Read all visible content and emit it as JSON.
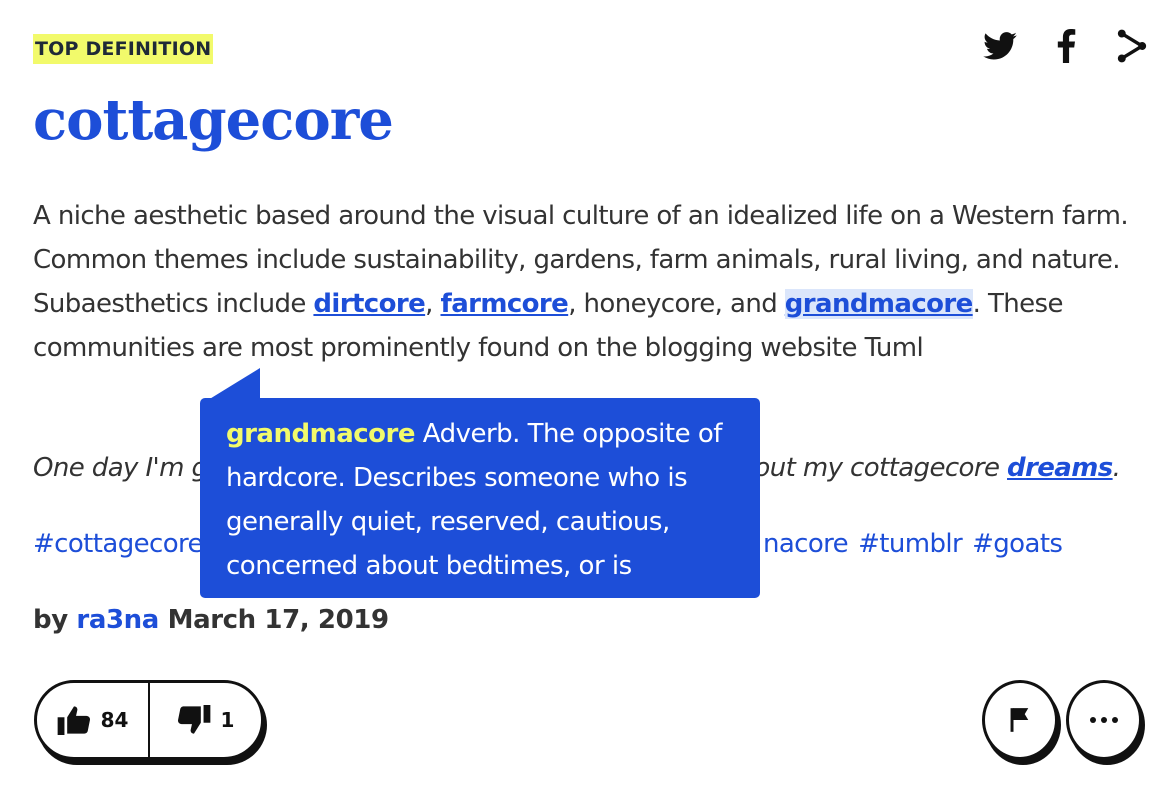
{
  "badge": "TOP DEFINITION",
  "share": {
    "icons": [
      "twitter-icon",
      "facebook-icon",
      "share-icon"
    ]
  },
  "word": "cottagecore",
  "meaning": {
    "t1": "A niche aesthetic based around the visual culture of an idealized life on a Western farm. Common themes include sustainability, gardens, farm animals, rural living, and nature. Subaesthetics include ",
    "link1": "dirtcore",
    "t2": ", ",
    "link2": "farmcore",
    "t3": ", honeycore, and ",
    "link3": "grandmacore",
    "t4": ". These communities are most prominently found on the blogging website Tuml"
  },
  "example": {
    "t1": "One day I'm g",
    "t2": "out my cottagecore ",
    "link": "dreams",
    "t3": "."
  },
  "tags": {
    "left": [
      "#cottagecore"
    ],
    "right": [
      "nacore",
      "#tumblr",
      "#goats"
    ]
  },
  "author": {
    "by": "by",
    "user": "ra3na",
    "date": "March 17, 2019"
  },
  "tooltip": {
    "word": "grandmacore",
    "text": " Adverb. The opposite of hardcore. Describes someone who is generally quiet, reserved, cautious, concerned about bedtimes, or is"
  },
  "votes": {
    "up": "84",
    "down": "1"
  },
  "colors": {
    "accent": "#1d4ed8",
    "badge": "#f2fa6b",
    "tooltip_word": "#f2fa6b"
  }
}
